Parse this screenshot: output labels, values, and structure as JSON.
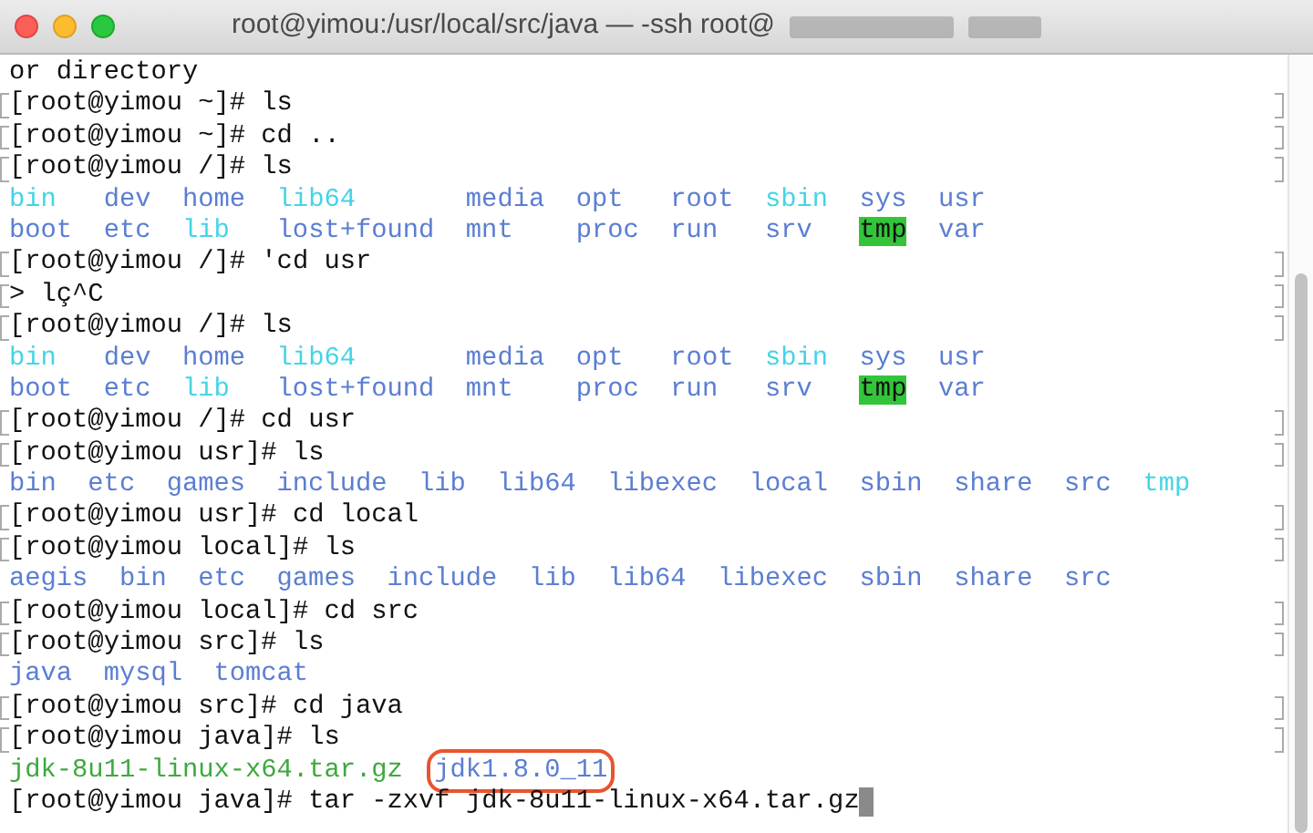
{
  "window": {
    "title": "root@yimou:/usr/local/src/java — -ssh root@"
  },
  "terminal": {
    "lines": [
      {
        "kind": "text",
        "text": "or directory",
        "marked": false
      },
      {
        "kind": "text",
        "text": "[root@yimou ~]# ls",
        "marked": true
      },
      {
        "kind": "text",
        "text": "[root@yimou ~]# cd ..",
        "marked": true
      },
      {
        "kind": "text",
        "text": "[root@yimou /]# ls",
        "marked": true
      },
      {
        "kind": "listing",
        "rows": [
          [
            {
              "name": "bin",
              "kind": "link"
            },
            {
              "name": "dev",
              "kind": "dir"
            },
            {
              "name": "home",
              "kind": "dir"
            },
            {
              "name": "lib64",
              "kind": "link"
            },
            {
              "name": "media",
              "kind": "dir"
            },
            {
              "name": "opt",
              "kind": "dir"
            },
            {
              "name": "root",
              "kind": "dir"
            },
            {
              "name": "sbin",
              "kind": "link"
            },
            {
              "name": "sys",
              "kind": "dir"
            },
            {
              "name": "usr",
              "kind": "dir"
            }
          ],
          [
            {
              "name": "boot",
              "kind": "dir"
            },
            {
              "name": "etc",
              "kind": "dir"
            },
            {
              "name": "lib",
              "kind": "link"
            },
            {
              "name": "lost+found",
              "kind": "dir"
            },
            {
              "name": "mnt",
              "kind": "dir"
            },
            {
              "name": "proc",
              "kind": "dir"
            },
            {
              "name": "run",
              "kind": "dir"
            },
            {
              "name": "srv",
              "kind": "dir"
            },
            {
              "name": "tmp",
              "kind": "sticky"
            },
            {
              "name": "var",
              "kind": "dir"
            }
          ]
        ]
      },
      {
        "kind": "text",
        "text": "[root@yimou /]# 'cd usr",
        "marked": true
      },
      {
        "kind": "text",
        "text": "> lç^C",
        "marked": true
      },
      {
        "kind": "text",
        "text": "[root@yimou /]# ls",
        "marked": true
      },
      {
        "kind": "listing",
        "rows": [
          [
            {
              "name": "bin",
              "kind": "link"
            },
            {
              "name": "dev",
              "kind": "dir"
            },
            {
              "name": "home",
              "kind": "dir"
            },
            {
              "name": "lib64",
              "kind": "link"
            },
            {
              "name": "media",
              "kind": "dir"
            },
            {
              "name": "opt",
              "kind": "dir"
            },
            {
              "name": "root",
              "kind": "dir"
            },
            {
              "name": "sbin",
              "kind": "link"
            },
            {
              "name": "sys",
              "kind": "dir"
            },
            {
              "name": "usr",
              "kind": "dir"
            }
          ],
          [
            {
              "name": "boot",
              "kind": "dir"
            },
            {
              "name": "etc",
              "kind": "dir"
            },
            {
              "name": "lib",
              "kind": "link"
            },
            {
              "name": "lost+found",
              "kind": "dir"
            },
            {
              "name": "mnt",
              "kind": "dir"
            },
            {
              "name": "proc",
              "kind": "dir"
            },
            {
              "name": "run",
              "kind": "dir"
            },
            {
              "name": "srv",
              "kind": "dir"
            },
            {
              "name": "tmp",
              "kind": "sticky"
            },
            {
              "name": "var",
              "kind": "dir"
            }
          ]
        ]
      },
      {
        "kind": "text",
        "text": "[root@yimou /]# cd usr",
        "marked": true
      },
      {
        "kind": "text",
        "text": "[root@yimou usr]# ls",
        "marked": true
      },
      {
        "kind": "listing",
        "rows": [
          [
            {
              "name": "bin",
              "kind": "dir"
            },
            {
              "name": "etc",
              "kind": "dir"
            },
            {
              "name": "games",
              "kind": "dir"
            },
            {
              "name": "include",
              "kind": "dir"
            },
            {
              "name": "lib",
              "kind": "dir"
            },
            {
              "name": "lib64",
              "kind": "dir"
            },
            {
              "name": "libexec",
              "kind": "dir"
            },
            {
              "name": "local",
              "kind": "dir"
            },
            {
              "name": "sbin",
              "kind": "dir"
            },
            {
              "name": "share",
              "kind": "dir"
            },
            {
              "name": "src",
              "kind": "dir"
            },
            {
              "name": "tmp",
              "kind": "link"
            }
          ]
        ]
      },
      {
        "kind": "text",
        "text": "[root@yimou usr]# cd local",
        "marked": true
      },
      {
        "kind": "text",
        "text": "[root@yimou local]# ls",
        "marked": true
      },
      {
        "kind": "listing",
        "rows": [
          [
            {
              "name": "aegis",
              "kind": "dir"
            },
            {
              "name": "bin",
              "kind": "dir"
            },
            {
              "name": "etc",
              "kind": "dir"
            },
            {
              "name": "games",
              "kind": "dir"
            },
            {
              "name": "include",
              "kind": "dir"
            },
            {
              "name": "lib",
              "kind": "dir"
            },
            {
              "name": "lib64",
              "kind": "dir"
            },
            {
              "name": "libexec",
              "kind": "dir"
            },
            {
              "name": "sbin",
              "kind": "dir"
            },
            {
              "name": "share",
              "kind": "dir"
            },
            {
              "name": "src",
              "kind": "dir"
            }
          ]
        ]
      },
      {
        "kind": "text",
        "text": "[root@yimou local]# cd src",
        "marked": true
      },
      {
        "kind": "text",
        "text": "[root@yimou src]# ls",
        "marked": true
      },
      {
        "kind": "listing",
        "rows": [
          [
            {
              "name": "java",
              "kind": "dir"
            },
            {
              "name": "mysql",
              "kind": "dir"
            },
            {
              "name": "tomcat",
              "kind": "dir"
            }
          ]
        ]
      },
      {
        "kind": "text",
        "text": "[root@yimou src]# cd java",
        "marked": true
      },
      {
        "kind": "text",
        "text": "[root@yimou java]# ls",
        "marked": true
      },
      {
        "kind": "listing",
        "rows": [
          [
            {
              "name": "jdk-8u11-linux-x64.tar.gz",
              "kind": "archive",
              "circled": false
            },
            {
              "name": "jdk1.8.0_11",
              "kind": "dir",
              "circled": true
            }
          ]
        ]
      },
      {
        "kind": "text",
        "text": "[root@yimou java]# tar -zxvf jdk-8u11-linux-x64.tar.gz",
        "marked": false,
        "cursor": true
      }
    ]
  }
}
